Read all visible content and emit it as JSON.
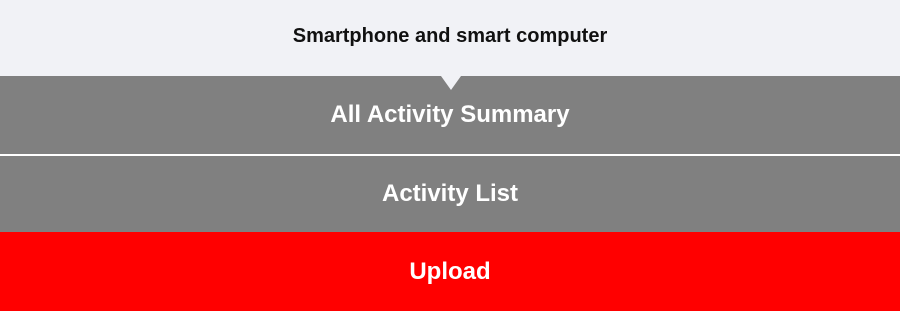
{
  "header": {
    "title": "Smartphone and smart computer"
  },
  "menu": {
    "items": [
      {
        "label": "All Activity Summary",
        "color": "#808080"
      },
      {
        "label": "Activity List",
        "color": "#808080"
      },
      {
        "label": "Upload",
        "color": "#ff0000"
      }
    ]
  }
}
